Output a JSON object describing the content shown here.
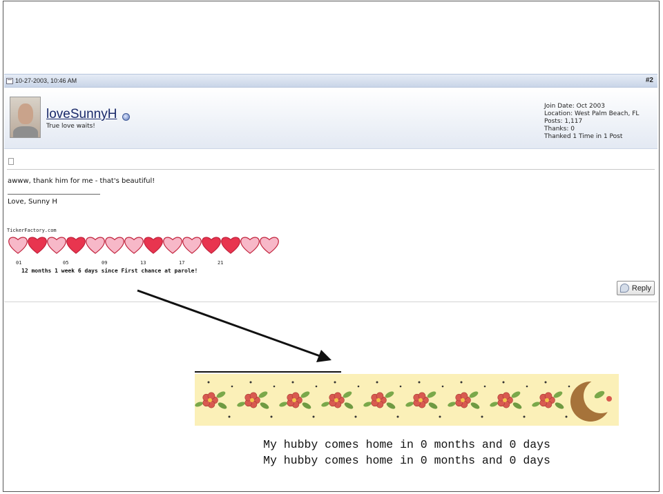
{
  "post": {
    "date": "10-27-2003, 10:46 AM",
    "number": "#2",
    "message": "awww, thank him for me - that's beautiful!",
    "signature": "Love, Sunny H"
  },
  "user": {
    "name": "loveSunnyH",
    "title": "True love waits!",
    "join_date": "Join Date: Oct 2003",
    "location": "Location: West Palm Beach, FL",
    "posts": "Posts: 1,117",
    "thanks": "Thanks: 0",
    "thanked": "Thanked 1 Time in 1 Post"
  },
  "ticker": {
    "brand": "TickerFactory.com",
    "numbers": [
      "01",
      "05",
      "09",
      "13",
      "17",
      "21"
    ],
    "text": "12 months 1 week  6 days since First chance at parole!",
    "heart_colors": [
      "#f7b8c8",
      "#e8354f",
      "#f7b8c8",
      "#e8354f",
      "#f7b8c8",
      "#f7b8c8",
      "#f7b8c8",
      "#e8354f",
      "#f7b8c8",
      "#f7b8c8",
      "#e8354f",
      "#e8354f",
      "#f7b8c8",
      "#f7b8c8"
    ]
  },
  "actions": {
    "reply_label": "Reply"
  },
  "banner": {
    "line1": "My hubby comes home in 0 months and 0 days",
    "line2": "My hubby comes home in 0 months and 0 days",
    "flower_count": 9
  }
}
